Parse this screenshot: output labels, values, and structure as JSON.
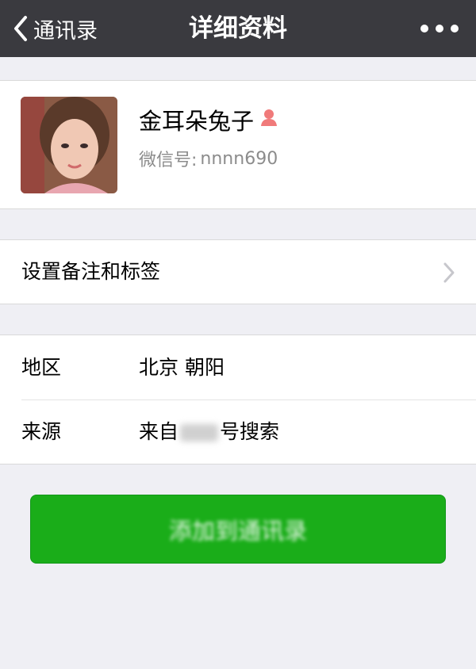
{
  "nav": {
    "back_label": "通讯录",
    "title": "详细资料"
  },
  "profile": {
    "nickname": "金耳朵兔子",
    "wechat_id_label": "微信号:",
    "wechat_id_value": "nnnn690",
    "gender_icon": "female-icon"
  },
  "remark": {
    "label": "设置备注和标签"
  },
  "info": {
    "region_label": "地区",
    "region_value": "北京 朝阳",
    "source_label": "来源",
    "source_prefix": "来自",
    "source_suffix": "号搜索"
  },
  "actions": {
    "add_label": "添加到通讯录"
  },
  "colors": {
    "navbar": "#3a3a3f",
    "background": "#efeff4",
    "accent_green": "#1aad19",
    "female_icon": "#f07a7a"
  }
}
